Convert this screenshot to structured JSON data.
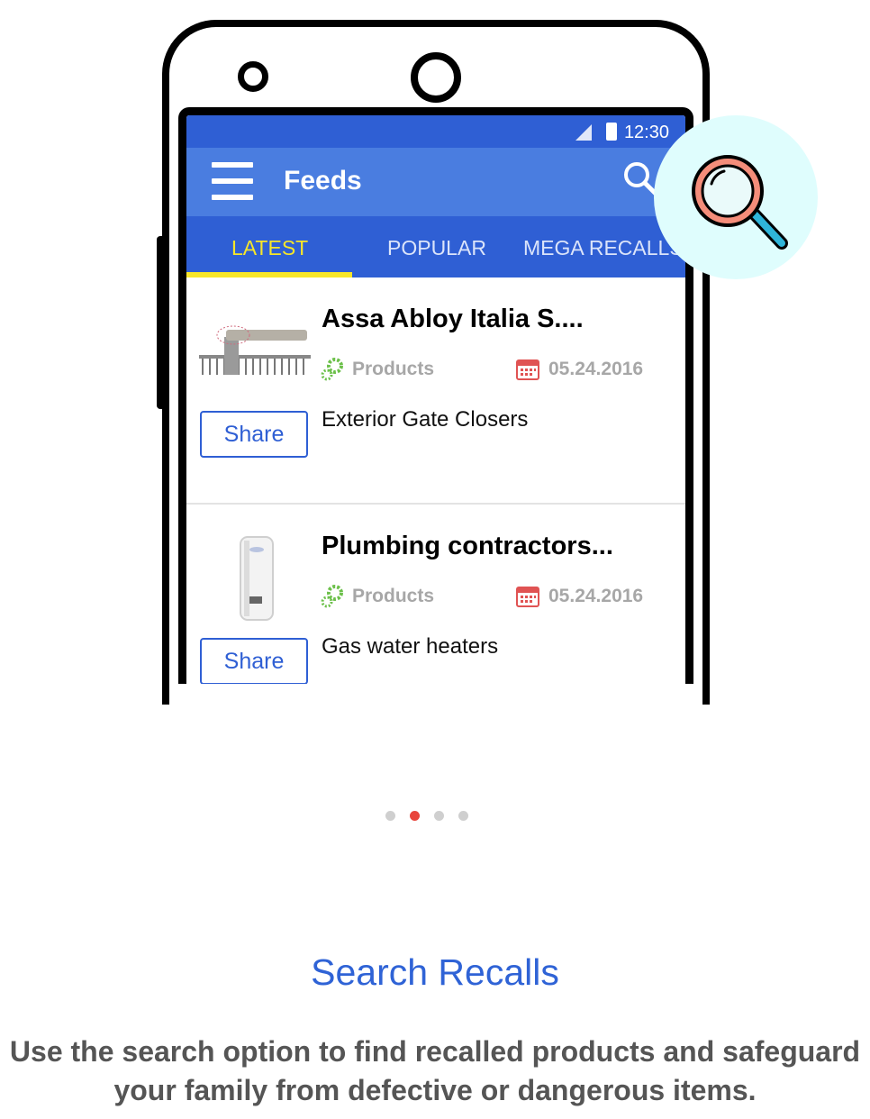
{
  "status_bar": {
    "time": "12:30"
  },
  "app_bar": {
    "title": "Feeds"
  },
  "tabs": [
    {
      "label": "LATEST",
      "active": true
    },
    {
      "label": "POPULAR",
      "active": false
    },
    {
      "label": "MEGA RECALLS",
      "active": false
    }
  ],
  "feed": [
    {
      "title": "Assa Abloy Italia S....",
      "category": "Products",
      "date": "05.24.2016",
      "description": "Exterior Gate Closers",
      "share_label": "Share",
      "thumb_icon": "gate-closer-image"
    },
    {
      "title": "Plumbing contractors...",
      "category": "Products",
      "date": "05.24.2016",
      "description": "Gas water heaters",
      "share_label": "Share",
      "thumb_icon": "water-heater-image"
    }
  ],
  "pager": {
    "count": 4,
    "active_index": 1
  },
  "headline": "Search Recalls",
  "description": "Use the search option to find recalled products and safeguard your family from defective or dangerous items.",
  "colors": {
    "primary": "#2f5fd4",
    "app_bar": "#4a7de0",
    "tab_active": "#f7e629",
    "headline": "#2f63d6",
    "pager_active": "#e8453c",
    "bubble": "#dffdfd"
  }
}
